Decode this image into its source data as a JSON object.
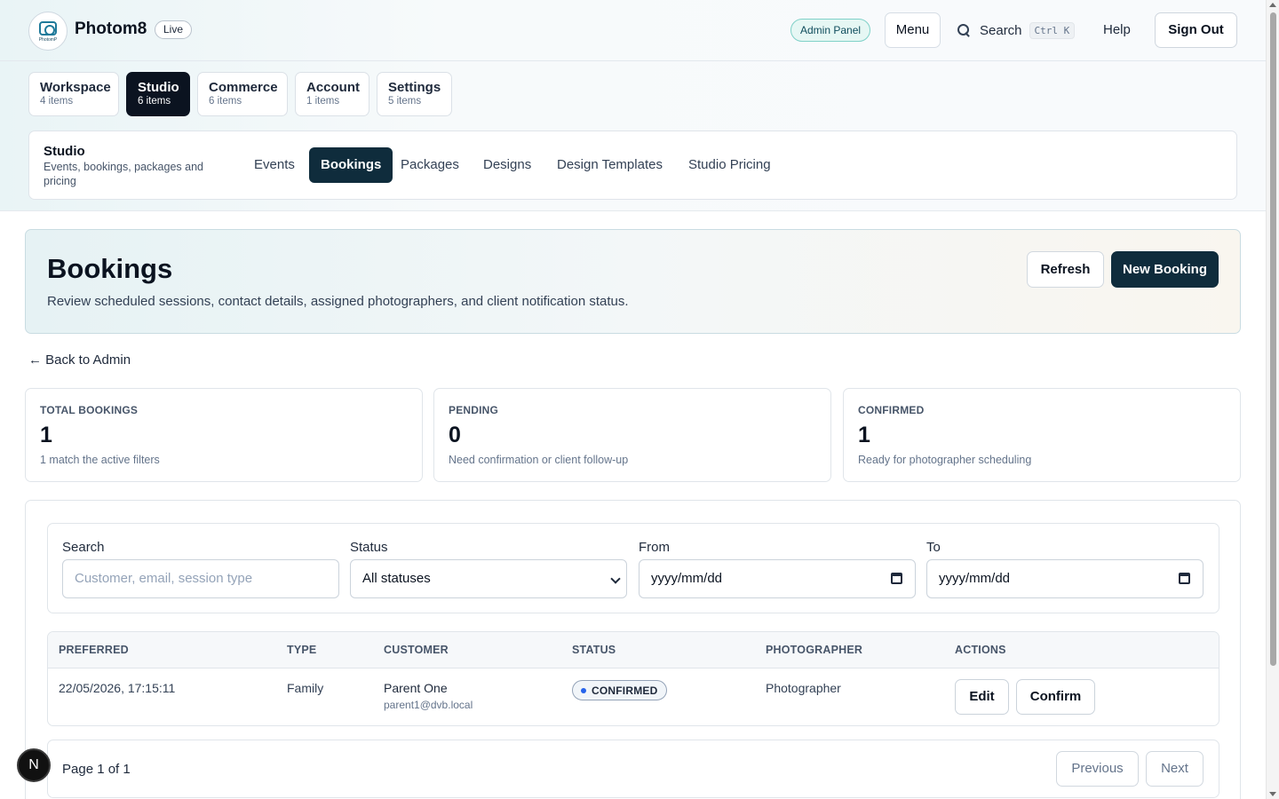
{
  "header": {
    "brand": "Photom8",
    "logo_text": "PhotomP",
    "live_badge": "Live",
    "admin_badge": "Admin Panel",
    "menu_label": "Menu",
    "search_label": "Search",
    "search_shortcut": "Ctrl K",
    "help_label": "Help",
    "sign_out_label": "Sign Out"
  },
  "categories": [
    {
      "label": "Workspace",
      "count": "4 items",
      "active": false
    },
    {
      "label": "Studio",
      "count": "6 items",
      "active": true
    },
    {
      "label": "Commerce",
      "count": "6 items",
      "active": false
    },
    {
      "label": "Account",
      "count": "1 items",
      "active": false
    },
    {
      "label": "Settings",
      "count": "5 items",
      "active": false
    }
  ],
  "subnav": {
    "title": "Studio",
    "description": "Events, bookings, packages and pricing",
    "links": [
      {
        "label": "Events",
        "active": false
      },
      {
        "label": "Bookings",
        "active": true
      },
      {
        "label": "Packages",
        "active": false
      },
      {
        "label": "Designs",
        "active": false
      },
      {
        "label": "Design Templates",
        "active": false
      },
      {
        "label": "Studio Pricing",
        "active": false
      }
    ]
  },
  "hero": {
    "title": "Bookings",
    "description": "Review scheduled sessions, contact details, assigned photographers, and client notification status.",
    "refresh_label": "Refresh",
    "new_booking_label": "New Booking"
  },
  "back_link": "← Back to Admin",
  "stats": [
    {
      "label": "TOTAL BOOKINGS",
      "value": "1",
      "sub": "1 match the active filters"
    },
    {
      "label": "PENDING",
      "value": "0",
      "sub": "Need confirmation or client follow-up"
    },
    {
      "label": "CONFIRMED",
      "value": "1",
      "sub": "Ready for photographer scheduling"
    }
  ],
  "filters": {
    "search_label": "Search",
    "search_placeholder": "Customer, email, session type",
    "status_label": "Status",
    "status_value": "All statuses",
    "from_label": "From",
    "from_value": "yyyy/mm/dd",
    "to_label": "To",
    "to_value": "yyyy/mm/dd"
  },
  "table": {
    "columns": [
      "PREFERRED",
      "TYPE",
      "CUSTOMER",
      "STATUS",
      "PHOTOGRAPHER",
      "ACTIONS"
    ],
    "rows": [
      {
        "preferred": "22/05/2026, 17:15:11",
        "type": "Family",
        "customer_name": "Parent One",
        "customer_email": "parent1@dvb.local",
        "status": "CONFIRMED",
        "photographer": "Photographer",
        "edit_label": "Edit",
        "confirm_label": "Confirm"
      }
    ]
  },
  "pagination": {
    "text": "Page 1 of 1",
    "previous_label": "Previous",
    "next_label": "Next"
  },
  "overlay_badge": "N",
  "colors": {
    "primary_dark": "#0f2c3c",
    "active_tab": "#0b1320",
    "admin_badge_bg": "#e6f7f4",
    "status_dot": "#2563eb"
  }
}
